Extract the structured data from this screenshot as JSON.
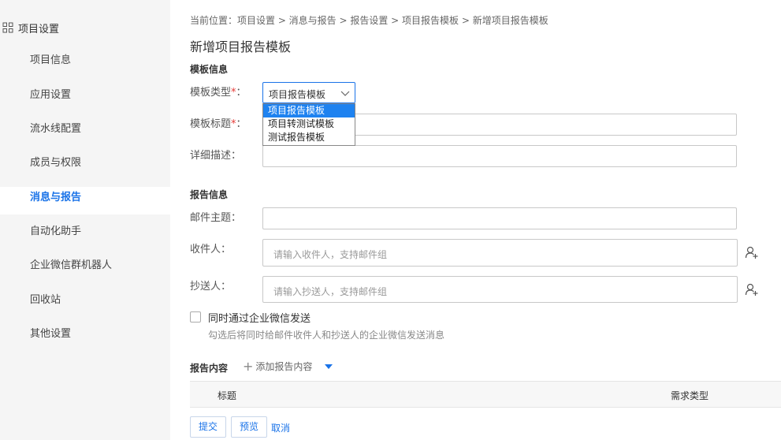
{
  "sidebar": {
    "title": "项目设置",
    "items": [
      {
        "label": "项目信息"
      },
      {
        "label": "应用设置"
      },
      {
        "label": "流水线配置"
      },
      {
        "label": "成员与权限"
      },
      {
        "label": "消息与报告",
        "active": true
      },
      {
        "label": "自动化助手"
      },
      {
        "label": "企业微信群机器人"
      },
      {
        "label": "回收站"
      },
      {
        "label": "其他设置"
      }
    ]
  },
  "breadcrumb": "当前位置：项目设置 > 消息与报告 > 报告设置 > 项目报告模板 > 新增项目报告模板",
  "page_title": "新增项目报告模板",
  "template_info": {
    "section_title": "模板信息",
    "type_label": "模板类型",
    "type_value": "项目报告模板",
    "type_options": [
      "项目报告模板",
      "项目转测试模板",
      "测试报告模板"
    ],
    "title_label": "模板标题",
    "desc_label": "详细描述："
  },
  "report_info": {
    "section_title": "报告信息",
    "subject_label": "邮件主题：",
    "recipients_label": "收件人：",
    "recipients_placeholder": "请输入收件人，支持邮件组",
    "cc_label": "抄送人：",
    "cc_placeholder": "请输入抄送人，支持邮件组",
    "wechat_label": "同时通过企业微信发送",
    "wechat_hint": "勾选后将同时给邮件收件人和抄送人的企业微信发送消息"
  },
  "report_content": {
    "title": "报告内容",
    "add_label": "添加报告内容",
    "columns": [
      "标题",
      "需求类型"
    ]
  },
  "actions": {
    "submit": "提交",
    "preview": "预览",
    "cancel": "取消"
  },
  "colors": {
    "accent": "#1a73e8",
    "required": "#e53935",
    "dropdown_selected": "#1e82f0"
  }
}
